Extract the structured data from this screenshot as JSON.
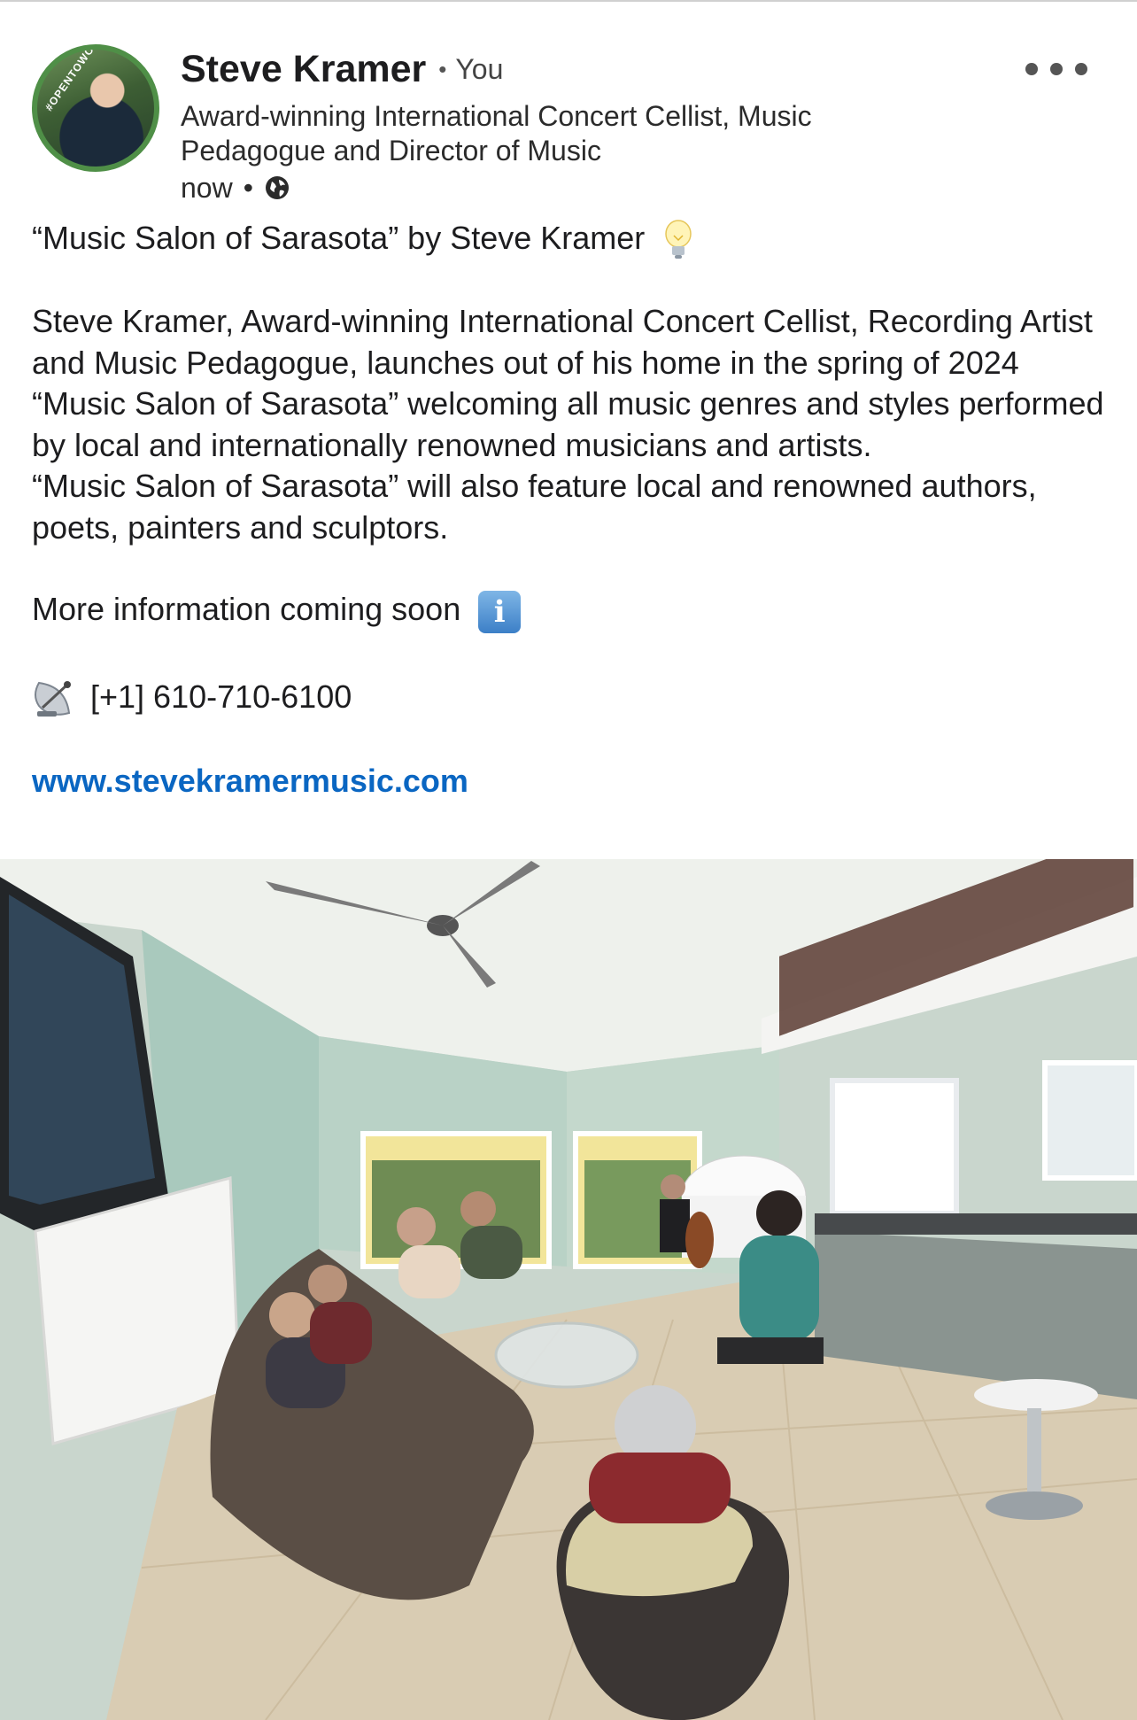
{
  "author": {
    "name": "Steve Kramer",
    "relation": "You",
    "headline": "Award-winning International Concert Cellist, Music Pedagogue and Director of Music",
    "timestamp": "now",
    "avatar_badge": "#OPENTOWORK"
  },
  "post": {
    "title_line": "“Music Salon of Sarasota” by Steve Kramer",
    "paragraph_1": "Steve Kramer, Award-winning International Concert Cellist, Recording Artist and Music Pedagogue, launches out of his home in the spring of 2024 “Music Salon of Sarasota” welcoming all music genres and styles performed by local and internationally renowned musicians and artists.",
    "paragraph_2": "“Music Salon of Sarasota” will also feature local and renowned authors, poets, painters and sculptors.",
    "more_info": "More information coming soon",
    "phone": "[+1] 610-710-6100",
    "website": "www.stevekramermusic.com"
  },
  "icons": {
    "title_emoji": "lightbulb-icon",
    "info_emoji": "information-icon",
    "phone_emoji": "satellite-dish-icon",
    "visibility": "globe-icon",
    "menu": "more-options-icon",
    "info_glyph": "i"
  },
  "colors": {
    "link": "#0a66c2",
    "opentowork_ring": "#4f8f47"
  }
}
